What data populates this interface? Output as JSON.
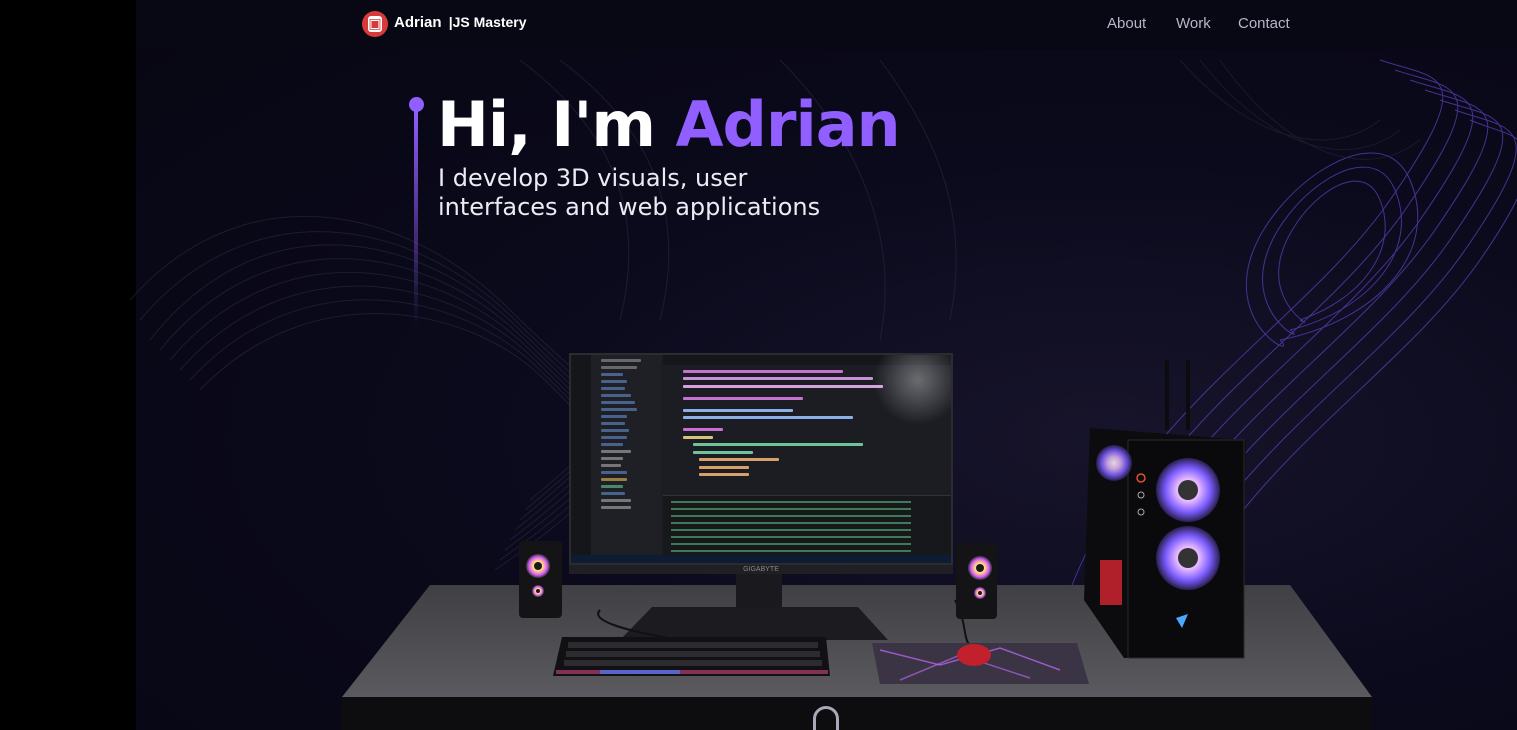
{
  "navbar": {
    "brand": "Adrian",
    "brand_suffix": "|JS Mastery",
    "logo_icon": "logo-icon",
    "links": [
      "About",
      "Work",
      "Contact"
    ]
  },
  "hero": {
    "greeting": "Hi, I'm ",
    "name": "Adrian",
    "subtitle": "I develop 3D visuals, user interfaces and web applications"
  },
  "monitor": {
    "brand": "GIGABYTE"
  },
  "colors": {
    "accent": "#915eff",
    "background": "#0b0a1c",
    "logo": "#d63a3a"
  },
  "icons": {
    "scroll": "mouse-scroll-icon"
  }
}
